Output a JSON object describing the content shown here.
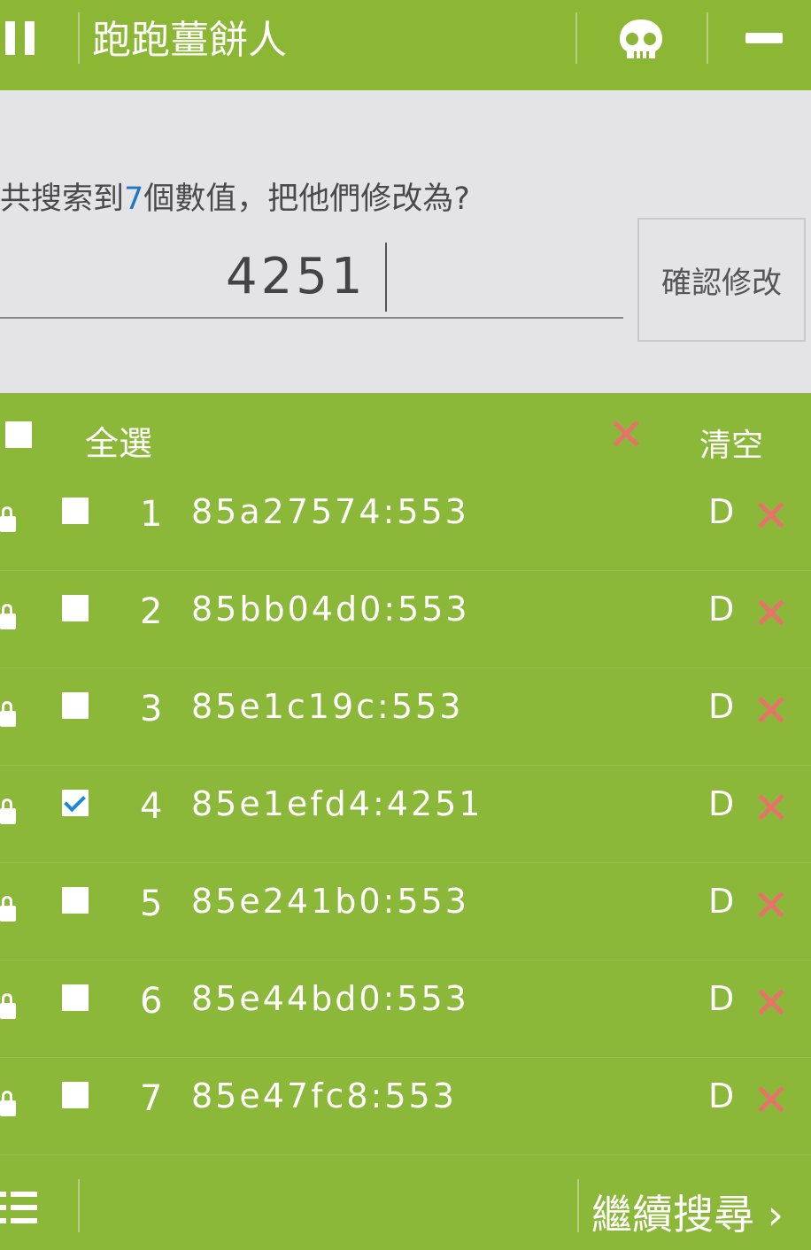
{
  "topbar": {
    "title": "跑跑薑餅人"
  },
  "edit": {
    "prompt_prefix": "共搜索到",
    "prompt_count": "7",
    "prompt_suffix": "個數值，把他們修改為?",
    "input_value": "4251",
    "confirm_label": "確認修改"
  },
  "list": {
    "select_all_label": "全選",
    "clear_label": "清空",
    "rows": [
      {
        "index": "1",
        "address": "85a27574:553",
        "type": "D",
        "checked": false
      },
      {
        "index": "2",
        "address": "85bb04d0:553",
        "type": "D",
        "checked": false
      },
      {
        "index": "3",
        "address": "85e1c19c:553",
        "type": "D",
        "checked": false
      },
      {
        "index": "4",
        "address": "85e1efd4:4251",
        "type": "D",
        "checked": true
      },
      {
        "index": "5",
        "address": "85e241b0:553",
        "type": "D",
        "checked": false
      },
      {
        "index": "6",
        "address": "85e44bd0:553",
        "type": "D",
        "checked": false
      },
      {
        "index": "7",
        "address": "85e47fc8:553",
        "type": "D",
        "checked": false
      }
    ]
  },
  "bottombar": {
    "continue_label": "繼續搜尋"
  },
  "colors": {
    "accent_green": "#8cb735",
    "delete_red": "#e8716c",
    "count_blue": "#1e78c2"
  },
  "icons": [
    "pause-icon",
    "skull-icon",
    "minimize-icon",
    "lock-icon",
    "delete-x-icon",
    "menu-list-icon",
    "chevron-right-icon"
  ]
}
